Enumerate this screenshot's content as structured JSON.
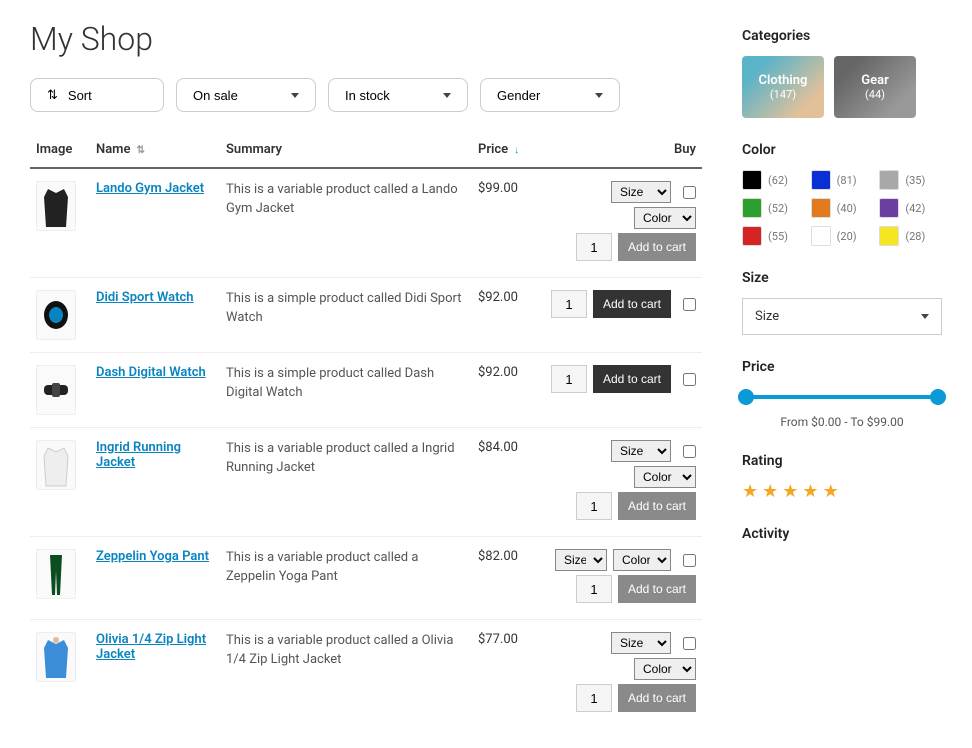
{
  "page_title": "My Shop",
  "filters": {
    "sort_label": "Sort",
    "onsale_label": "On sale",
    "instock_label": "In stock",
    "gender_label": "Gender"
  },
  "table": {
    "headers": {
      "image": "Image",
      "name": "Name",
      "summary": "Summary",
      "price": "Price",
      "buy": "Buy"
    },
    "size_option": "Size",
    "color_option": "Color",
    "qty_default": "1",
    "add_to_cart": "Add to cart",
    "rows": [
      {
        "name": "Lando Gym Jacket",
        "summary": "This is a variable product called a Lando Gym Jacket",
        "price": "$99.00",
        "variable": true,
        "inlineVariant": false,
        "thumbStyle": "jacket-dark"
      },
      {
        "name": "Didi Sport Watch",
        "summary": "This is a simple product called Didi Sport Watch",
        "price": "$92.00",
        "variable": false,
        "inlineVariant": false,
        "thumbStyle": "watch"
      },
      {
        "name": "Dash Digital Watch",
        "summary": "This is a simple product called Dash Digital Watch",
        "price": "$92.00",
        "variable": false,
        "inlineVariant": false,
        "thumbStyle": "watch-band"
      },
      {
        "name": "Ingrid Running Jacket",
        "summary": "This is a variable product called a Ingrid Running Jacket",
        "price": "$84.00",
        "variable": true,
        "inlineVariant": false,
        "thumbStyle": "jacket-light"
      },
      {
        "name": "Zeppelin Yoga Pant",
        "summary": "This is a variable product called a Zeppelin Yoga Pant",
        "price": "$82.00",
        "variable": true,
        "inlineVariant": true,
        "thumbStyle": "pant"
      },
      {
        "name": "Olivia 1/4 Zip Light Jacket",
        "summary": "This is a variable product called a Olivia 1/4 Zip Light Jacket",
        "price": "$77.00",
        "variable": true,
        "inlineVariant": false,
        "thumbStyle": "jacket-blue"
      }
    ]
  },
  "sidebar": {
    "categories_title": "Categories",
    "categories": [
      {
        "name": "Clothing",
        "count": "(147)"
      },
      {
        "name": "Gear",
        "count": "(44)"
      }
    ],
    "color_title": "Color",
    "colors": [
      {
        "hex": "#000000",
        "count": "(62)"
      },
      {
        "hex": "#0a2fd6",
        "count": "(81)"
      },
      {
        "hex": "#a8a8a8",
        "count": "(35)"
      },
      {
        "hex": "#2ca02c",
        "count": "(52)"
      },
      {
        "hex": "#e07b1f",
        "count": "(40)"
      },
      {
        "hex": "#6b3fa0",
        "count": "(42)"
      },
      {
        "hex": "#d62424",
        "count": "(55)"
      },
      {
        "hex": "#ffffff",
        "count": "(20)"
      },
      {
        "hex": "#f5e623",
        "count": "(28)"
      }
    ],
    "size_title": "Size",
    "size_placeholder": "Size",
    "price_title": "Price",
    "price_range": "From $0.00 - To $99.00",
    "rating_title": "Rating",
    "activity_title": "Activity"
  }
}
